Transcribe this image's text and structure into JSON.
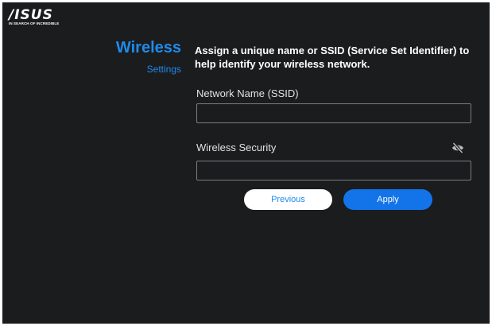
{
  "brand": {
    "logo_text": "/ISUS",
    "tagline": "IN SEARCH OF INCREDIBLE"
  },
  "section": {
    "title": "Wireless",
    "subtitle": "Settings",
    "description": "Assign a unique name or SSID (Service Set Identifier) to help identify your wireless network."
  },
  "form": {
    "ssid_label": "Network Name (SSID)",
    "ssid_value": "",
    "security_label": "Wireless Security",
    "security_value": "",
    "password_visibility_icon": "eye-slash-icon"
  },
  "buttons": {
    "previous_label": "Previous",
    "apply_label": "Apply"
  },
  "colors": {
    "background": "#1b1c1e",
    "accent": "#1e8bea",
    "apply_button": "#1274e8",
    "input_border": "#7b7d80"
  }
}
